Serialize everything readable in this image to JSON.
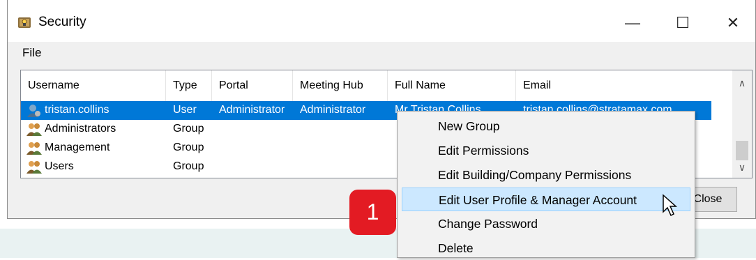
{
  "window": {
    "title": "Security",
    "controls": {
      "minimize": "—",
      "maximize": "☐",
      "close": "✕"
    }
  },
  "menubar": {
    "file": "File"
  },
  "table": {
    "columns": [
      "Username",
      "Type",
      "Portal",
      "Meeting Hub",
      "Full Name",
      "Email"
    ],
    "rows": [
      {
        "username": "tristan.collins",
        "type": "User",
        "portal": "Administrator",
        "meeting_hub": "Administrator",
        "full_name": "Mr Tristan Collins",
        "email": "tristan.collins@stratamax.com",
        "icon": "user-icon",
        "selected": true
      },
      {
        "username": "Administrators",
        "type": "Group",
        "portal": "",
        "meeting_hub": "",
        "full_name": "",
        "email": "",
        "icon": "group-icon"
      },
      {
        "username": "Management",
        "type": "Group",
        "portal": "",
        "meeting_hub": "",
        "full_name": "",
        "email": "",
        "icon": "group-icon"
      },
      {
        "username": "Users",
        "type": "Group",
        "portal": "",
        "meeting_hub": "",
        "full_name": "",
        "email": "",
        "icon": "group-icon"
      }
    ]
  },
  "buttons": {
    "close": "Close"
  },
  "context_menu": {
    "items": [
      "New Group",
      "Edit Permissions",
      "Edit Building/Company Permissions",
      "Edit User Profile & Manager Account",
      "Change Password",
      "Delete"
    ],
    "highlighted_index": 3
  },
  "annotation": {
    "badge_number": "1",
    "color": "#e31b23"
  },
  "colors": {
    "selection": "#0078d7",
    "menu_highlight": "#cce8ff"
  }
}
